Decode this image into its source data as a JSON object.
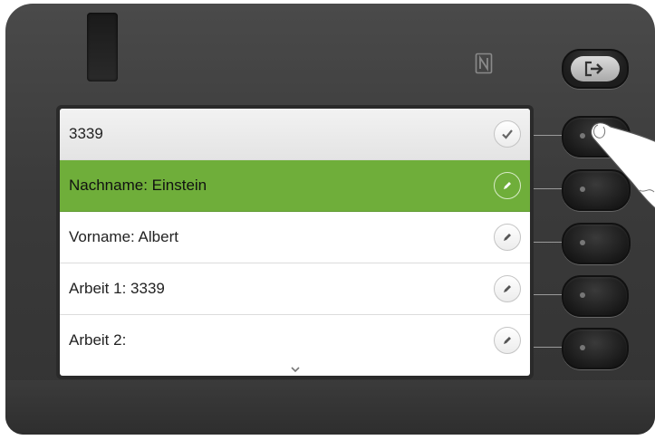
{
  "icons": {
    "nfc": "nfc-icon",
    "logout": "logout-icon",
    "confirm": "check-icon",
    "edit": "pencil-icon",
    "scroll": "chevron-down-icon"
  },
  "colors": {
    "selected_row": "#6fae3a",
    "device_body": "#3a3a3a"
  },
  "screen": {
    "rows": [
      {
        "label": "3339",
        "icon": "check-icon"
      },
      {
        "label": "Nachname: Einstein",
        "icon": "pencil-icon",
        "selected": true
      },
      {
        "label": "Vorname: Albert",
        "icon": "pencil-icon"
      },
      {
        "label": "Arbeit 1: 3339",
        "icon": "pencil-icon"
      },
      {
        "label": "Arbeit 2:",
        "icon": "pencil-icon"
      }
    ]
  }
}
